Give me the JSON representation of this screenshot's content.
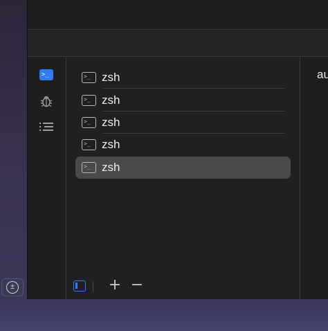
{
  "sessions": [
    {
      "label": "zsh",
      "selected": false
    },
    {
      "label": "zsh",
      "selected": false
    },
    {
      "label": "zsh",
      "selected": false
    },
    {
      "label": "zsh",
      "selected": false
    },
    {
      "label": "zsh",
      "selected": true
    }
  ],
  "detail": {
    "text": "au"
  },
  "rail": {
    "items": [
      {
        "icon": "terminal-icon",
        "active": true
      },
      {
        "icon": "bug-icon",
        "active": false
      },
      {
        "icon": "list-icon",
        "active": false
      }
    ]
  },
  "footer": {
    "add_label": "+",
    "remove_label": "−"
  },
  "colors": {
    "accent": "#2f7cf6",
    "selection": "#4a4a4a",
    "panel_bg": "#202020"
  }
}
